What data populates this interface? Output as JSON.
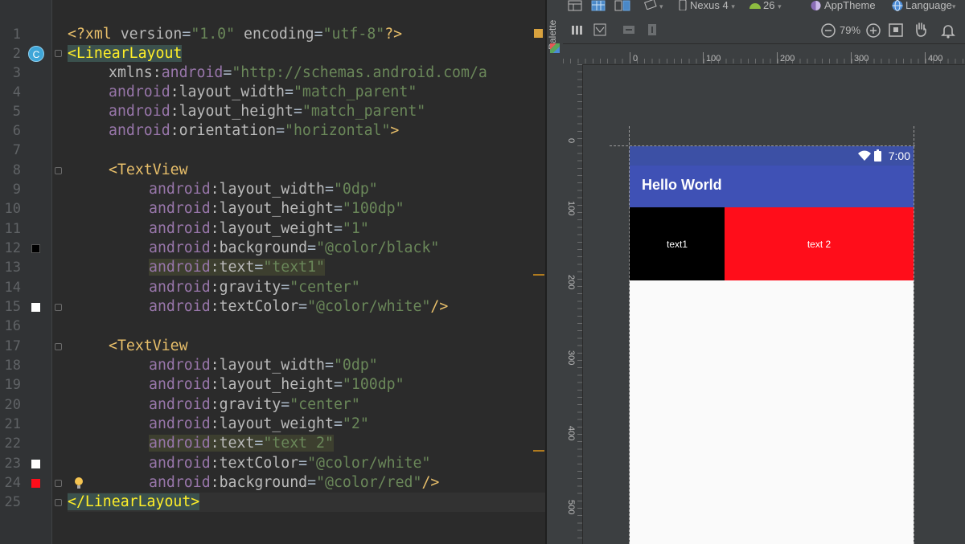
{
  "editor": {
    "line_numbers": [
      "1",
      "2",
      "3",
      "4",
      "5",
      "6",
      "7",
      "8",
      "9",
      "10",
      "11",
      "12",
      "13",
      "14",
      "15",
      "16",
      "17",
      "18",
      "19",
      "20",
      "21",
      "22",
      "23",
      "24",
      "25"
    ],
    "lines": {
      "l1": {
        "a": "<?xml ",
        "b": "version",
        "c": "=",
        "d": "\"1.0\"",
        "e": " ",
        "f": "encoding",
        "g": "=",
        "h": "\"utf-8\"",
        "i": "?>"
      },
      "l2": {
        "a": "<LinearLayout"
      },
      "l3": {
        "a": "xmlns:",
        "b": "android",
        "c": "=",
        "d": "\"http://schemas.android.com/a"
      },
      "l4": {
        "a": "android",
        "b": ":layout_width",
        "c": "=",
        "d": "\"match_parent\""
      },
      "l5": {
        "a": "android",
        "b": ":layout_height",
        "c": "=",
        "d": "\"match_parent\""
      },
      "l6": {
        "a": "android",
        "b": ":orientation",
        "c": "=",
        "d": "\"horizontal\"",
        "e": ">"
      },
      "l8": {
        "a": "<TextView"
      },
      "l9": {
        "a": "android",
        "b": ":layout_width",
        "c": "=",
        "d": "\"0dp\""
      },
      "l10": {
        "a": "android",
        "b": ":layout_height",
        "c": "=",
        "d": "\"100dp\""
      },
      "l11": {
        "a": "android",
        "b": ":layout_weight",
        "c": "=",
        "d": "\"1\""
      },
      "l12": {
        "a": "android",
        "b": ":background",
        "c": "=",
        "d": "\"@color/black\""
      },
      "l13": {
        "a": "android",
        "b": ":text",
        "c": "=",
        "d": "\"text1\""
      },
      "l14": {
        "a": "android",
        "b": ":gravity",
        "c": "=",
        "d": "\"center\""
      },
      "l15": {
        "a": "android",
        "b": ":textColor",
        "c": "=",
        "d": "\"@color/white\"",
        "e": "/>"
      },
      "l17": {
        "a": "<TextView"
      },
      "l18": {
        "a": "android",
        "b": ":layout_width",
        "c": "=",
        "d": "\"0dp\""
      },
      "l19": {
        "a": "android",
        "b": ":layout_height",
        "c": "=",
        "d": "\"100dp\""
      },
      "l20": {
        "a": "android",
        "b": ":gravity",
        "c": "=",
        "d": "\"center\""
      },
      "l21": {
        "a": "android",
        "b": ":layout_weight",
        "c": "=",
        "d": "\"2\""
      },
      "l22": {
        "a": "android",
        "b": ":text",
        "c": "=",
        "d": "\"text 2\""
      },
      "l23": {
        "a": "android",
        "b": ":textColor",
        "c": "=",
        "d": "\"@color/white\""
      },
      "l24": {
        "a": "android",
        "b": ":background",
        "c": "=",
        "d": "\"@color/red\"",
        "e": "/>"
      },
      "l25": {
        "a": "</LinearLayout>"
      }
    },
    "class_badge": "C",
    "colors": {
      "black_swatch": "#000000",
      "white_swatch": "#ffffff",
      "red_swatch": "#ff0d1a"
    }
  },
  "designer": {
    "palette_label": "Palette",
    "toolbar": {
      "device": "Nexus 4",
      "api": "26",
      "theme": "AppTheme",
      "language": "Language",
      "zoom": "79%"
    },
    "ruler_top": [
      "0",
      "100",
      "200",
      "300",
      "400"
    ],
    "ruler_left": [
      "0",
      "100",
      "200",
      "300",
      "400",
      "500"
    ],
    "preview": {
      "clock": "7:00",
      "app_title": "Hello World",
      "text1": "text1",
      "text2": "text 2",
      "colors": {
        "status_bar": "#3c50a5",
        "app_bar": "#3f51b5",
        "text1_bg": "#000000",
        "text2_bg": "#ff0d1a"
      }
    }
  }
}
